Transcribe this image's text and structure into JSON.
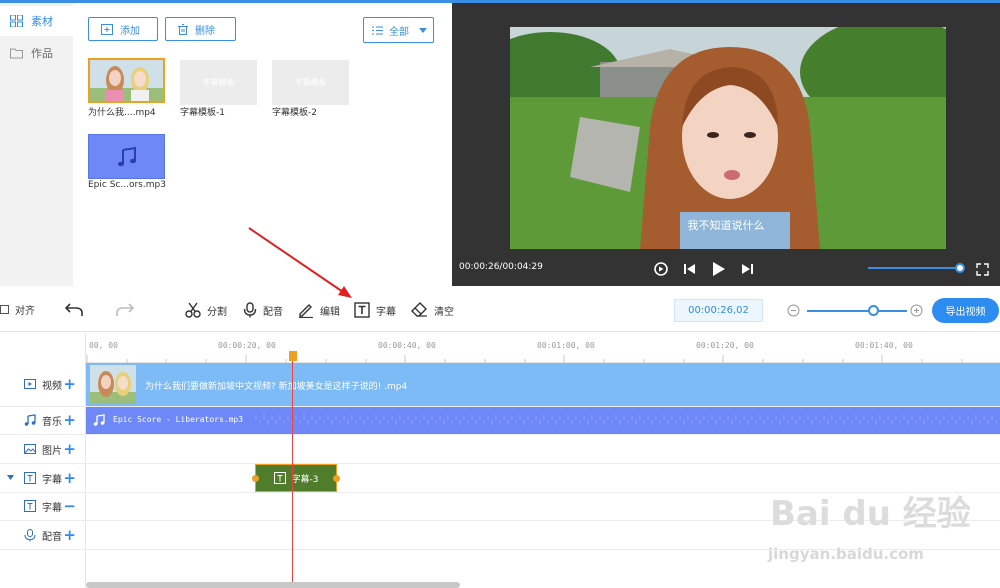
{
  "nav": {
    "items": [
      {
        "label": "素材",
        "icon": "grid-icon",
        "active": true
      },
      {
        "label": "作品",
        "icon": "folder-icon",
        "active": false
      }
    ]
  },
  "library": {
    "add_label": "添加",
    "delete_label": "删除",
    "filter_label": "全部",
    "items": [
      {
        "caption": "为什么我....mp4",
        "type": "video"
      },
      {
        "caption": "字幕模板-1",
        "type": "template",
        "inner_text": "字幕模板"
      },
      {
        "caption": "字幕模板-2",
        "type": "template",
        "inner_text": "字幕模板"
      },
      {
        "caption": "Epic Sc...ors.mp3",
        "type": "audio"
      }
    ]
  },
  "preview": {
    "subtitle": "我不知道说什么",
    "time": "00:00:26/00:04:29"
  },
  "toolbar": {
    "align_label": "对齐",
    "split_label": "分割",
    "dub_label": "配音",
    "edit_label": "编辑",
    "subtitle_label": "字幕",
    "clear_label": "清空",
    "current_time": "00:00:26,02",
    "export_label": "导出视频"
  },
  "ruler": {
    "ticks": [
      "00, 00",
      "00:00:20, 00",
      "00:00:40, 00",
      "00:01:00, 00",
      "00:01:20, 00",
      "00:01:40, 00"
    ]
  },
  "tracks": {
    "video_label": "视频",
    "music_label": "音乐",
    "image_label": "图片",
    "subtitle_label": "字幕",
    "subtitle2_label": "字幕",
    "dub_label": "配音",
    "video_clip_name": "为什么我们要做新加坡中文视频? 新加坡美女是这样子说的! .mp4",
    "audio_clip_name": "Epic Score - Liberators.mp3",
    "subtitle_clip_name": "字幕-3"
  },
  "watermark": {
    "brand": "Bai du 经验",
    "url": "jingyan.baidu.com"
  },
  "colors": {
    "accent": "#2d8cf0",
    "video_track": "#7dbbf7",
    "audio_track": "#6f88f7",
    "subtitle_clip": "#4f7d2c",
    "playhead": "#f04040"
  }
}
